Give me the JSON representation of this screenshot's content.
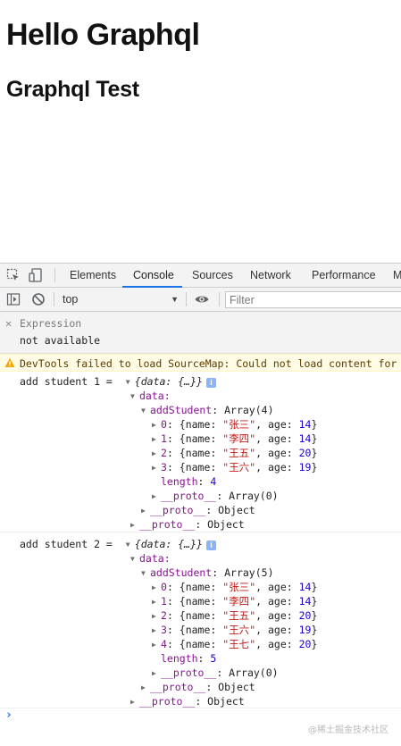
{
  "page": {
    "heading": "Hello Graphql",
    "subheading": "Graphql Test"
  },
  "devtools": {
    "tabs": [
      "Elements",
      "Console",
      "Sources",
      "Network",
      "Performance",
      "M"
    ],
    "active_tab": "Console",
    "context": "top",
    "filter_placeholder": "Filter",
    "expression": {
      "label": "Expression",
      "value": "not available"
    },
    "warning": {
      "text": "DevTools failed to load SourceMap: Could not load content for ",
      "link": "chr"
    },
    "logs": [
      {
        "prefix": "add student 1 = ",
        "summary": "{data: {…}}",
        "data_key": "data:",
        "field": "addStudent",
        "type": "Array(4)",
        "items": [
          {
            "idx": "0",
            "name": "张三",
            "age": "14"
          },
          {
            "idx": "1",
            "name": "李四",
            "age": "14"
          },
          {
            "idx": "2",
            "name": "王五",
            "age": "20"
          },
          {
            "idx": "3",
            "name": "王六",
            "age": "19"
          }
        ],
        "length": "4",
        "proto_array": "Array(0)",
        "proto_object": "Object"
      },
      {
        "prefix": "add student 2 = ",
        "summary": "{data: {…}}",
        "data_key": "data:",
        "field": "addStudent",
        "type": "Array(5)",
        "items": [
          {
            "idx": "0",
            "name": "张三",
            "age": "14"
          },
          {
            "idx": "1",
            "name": "李四",
            "age": "14"
          },
          {
            "idx": "2",
            "name": "王五",
            "age": "20"
          },
          {
            "idx": "3",
            "name": "王六",
            "age": "19"
          },
          {
            "idx": "4",
            "name": "王七",
            "age": "20"
          }
        ],
        "length": "5",
        "proto_array": "Array(0)",
        "proto_object": "Object"
      }
    ],
    "watermark": "@稀土掘金技术社区"
  }
}
